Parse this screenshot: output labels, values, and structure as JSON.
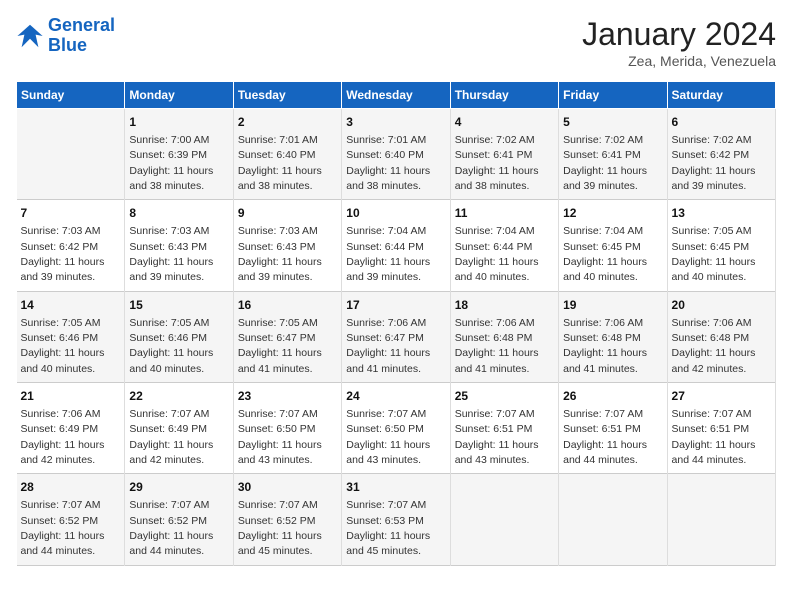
{
  "header": {
    "logo_line1": "General",
    "logo_line2": "Blue",
    "title": "January 2024",
    "subtitle": "Zea, Merida, Venezuela"
  },
  "days_of_week": [
    "Sunday",
    "Monday",
    "Tuesday",
    "Wednesday",
    "Thursday",
    "Friday",
    "Saturday"
  ],
  "weeks": [
    [
      {
        "num": "",
        "sunrise": "",
        "sunset": "",
        "daylight": ""
      },
      {
        "num": "1",
        "sunrise": "Sunrise: 7:00 AM",
        "sunset": "Sunset: 6:39 PM",
        "daylight": "Daylight: 11 hours and 38 minutes."
      },
      {
        "num": "2",
        "sunrise": "Sunrise: 7:01 AM",
        "sunset": "Sunset: 6:40 PM",
        "daylight": "Daylight: 11 hours and 38 minutes."
      },
      {
        "num": "3",
        "sunrise": "Sunrise: 7:01 AM",
        "sunset": "Sunset: 6:40 PM",
        "daylight": "Daylight: 11 hours and 38 minutes."
      },
      {
        "num": "4",
        "sunrise": "Sunrise: 7:02 AM",
        "sunset": "Sunset: 6:41 PM",
        "daylight": "Daylight: 11 hours and 38 minutes."
      },
      {
        "num": "5",
        "sunrise": "Sunrise: 7:02 AM",
        "sunset": "Sunset: 6:41 PM",
        "daylight": "Daylight: 11 hours and 39 minutes."
      },
      {
        "num": "6",
        "sunrise": "Sunrise: 7:02 AM",
        "sunset": "Sunset: 6:42 PM",
        "daylight": "Daylight: 11 hours and 39 minutes."
      }
    ],
    [
      {
        "num": "7",
        "sunrise": "Sunrise: 7:03 AM",
        "sunset": "Sunset: 6:42 PM",
        "daylight": "Daylight: 11 hours and 39 minutes."
      },
      {
        "num": "8",
        "sunrise": "Sunrise: 7:03 AM",
        "sunset": "Sunset: 6:43 PM",
        "daylight": "Daylight: 11 hours and 39 minutes."
      },
      {
        "num": "9",
        "sunrise": "Sunrise: 7:03 AM",
        "sunset": "Sunset: 6:43 PM",
        "daylight": "Daylight: 11 hours and 39 minutes."
      },
      {
        "num": "10",
        "sunrise": "Sunrise: 7:04 AM",
        "sunset": "Sunset: 6:44 PM",
        "daylight": "Daylight: 11 hours and 39 minutes."
      },
      {
        "num": "11",
        "sunrise": "Sunrise: 7:04 AM",
        "sunset": "Sunset: 6:44 PM",
        "daylight": "Daylight: 11 hours and 40 minutes."
      },
      {
        "num": "12",
        "sunrise": "Sunrise: 7:04 AM",
        "sunset": "Sunset: 6:45 PM",
        "daylight": "Daylight: 11 hours and 40 minutes."
      },
      {
        "num": "13",
        "sunrise": "Sunrise: 7:05 AM",
        "sunset": "Sunset: 6:45 PM",
        "daylight": "Daylight: 11 hours and 40 minutes."
      }
    ],
    [
      {
        "num": "14",
        "sunrise": "Sunrise: 7:05 AM",
        "sunset": "Sunset: 6:46 PM",
        "daylight": "Daylight: 11 hours and 40 minutes."
      },
      {
        "num": "15",
        "sunrise": "Sunrise: 7:05 AM",
        "sunset": "Sunset: 6:46 PM",
        "daylight": "Daylight: 11 hours and 40 minutes."
      },
      {
        "num": "16",
        "sunrise": "Sunrise: 7:05 AM",
        "sunset": "Sunset: 6:47 PM",
        "daylight": "Daylight: 11 hours and 41 minutes."
      },
      {
        "num": "17",
        "sunrise": "Sunrise: 7:06 AM",
        "sunset": "Sunset: 6:47 PM",
        "daylight": "Daylight: 11 hours and 41 minutes."
      },
      {
        "num": "18",
        "sunrise": "Sunrise: 7:06 AM",
        "sunset": "Sunset: 6:48 PM",
        "daylight": "Daylight: 11 hours and 41 minutes."
      },
      {
        "num": "19",
        "sunrise": "Sunrise: 7:06 AM",
        "sunset": "Sunset: 6:48 PM",
        "daylight": "Daylight: 11 hours and 41 minutes."
      },
      {
        "num": "20",
        "sunrise": "Sunrise: 7:06 AM",
        "sunset": "Sunset: 6:48 PM",
        "daylight": "Daylight: 11 hours and 42 minutes."
      }
    ],
    [
      {
        "num": "21",
        "sunrise": "Sunrise: 7:06 AM",
        "sunset": "Sunset: 6:49 PM",
        "daylight": "Daylight: 11 hours and 42 minutes."
      },
      {
        "num": "22",
        "sunrise": "Sunrise: 7:07 AM",
        "sunset": "Sunset: 6:49 PM",
        "daylight": "Daylight: 11 hours and 42 minutes."
      },
      {
        "num": "23",
        "sunrise": "Sunrise: 7:07 AM",
        "sunset": "Sunset: 6:50 PM",
        "daylight": "Daylight: 11 hours and 43 minutes."
      },
      {
        "num": "24",
        "sunrise": "Sunrise: 7:07 AM",
        "sunset": "Sunset: 6:50 PM",
        "daylight": "Daylight: 11 hours and 43 minutes."
      },
      {
        "num": "25",
        "sunrise": "Sunrise: 7:07 AM",
        "sunset": "Sunset: 6:51 PM",
        "daylight": "Daylight: 11 hours and 43 minutes."
      },
      {
        "num": "26",
        "sunrise": "Sunrise: 7:07 AM",
        "sunset": "Sunset: 6:51 PM",
        "daylight": "Daylight: 11 hours and 44 minutes."
      },
      {
        "num": "27",
        "sunrise": "Sunrise: 7:07 AM",
        "sunset": "Sunset: 6:51 PM",
        "daylight": "Daylight: 11 hours and 44 minutes."
      }
    ],
    [
      {
        "num": "28",
        "sunrise": "Sunrise: 7:07 AM",
        "sunset": "Sunset: 6:52 PM",
        "daylight": "Daylight: 11 hours and 44 minutes."
      },
      {
        "num": "29",
        "sunrise": "Sunrise: 7:07 AM",
        "sunset": "Sunset: 6:52 PM",
        "daylight": "Daylight: 11 hours and 44 minutes."
      },
      {
        "num": "30",
        "sunrise": "Sunrise: 7:07 AM",
        "sunset": "Sunset: 6:52 PM",
        "daylight": "Daylight: 11 hours and 45 minutes."
      },
      {
        "num": "31",
        "sunrise": "Sunrise: 7:07 AM",
        "sunset": "Sunset: 6:53 PM",
        "daylight": "Daylight: 11 hours and 45 minutes."
      },
      {
        "num": "",
        "sunrise": "",
        "sunset": "",
        "daylight": ""
      },
      {
        "num": "",
        "sunrise": "",
        "sunset": "",
        "daylight": ""
      },
      {
        "num": "",
        "sunrise": "",
        "sunset": "",
        "daylight": ""
      }
    ]
  ]
}
